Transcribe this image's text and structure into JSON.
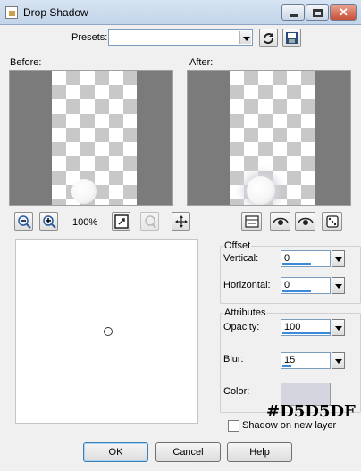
{
  "window": {
    "title": "Drop Shadow"
  },
  "presets": {
    "label": "Presets:",
    "value": ""
  },
  "preview": {
    "before_label": "Before:",
    "after_label": "After:",
    "zoom": "100%"
  },
  "offset": {
    "title": "Offset",
    "vertical_label": "Vertical:",
    "vertical_value": "0",
    "vertical_fill": 0.6,
    "horizontal_label": "Horizontal:",
    "horizontal_value": "0",
    "horizontal_fill": 0.6
  },
  "attributes": {
    "title": "Attributes",
    "opacity_label": "Opacity:",
    "opacity_value": "100",
    "opacity_fill": 1.0,
    "blur_label": "Blur:",
    "blur_value": "15",
    "blur_fill": 0.18,
    "color_label": "Color:",
    "color_value": "#D5D5DF"
  },
  "shadow_new_layer": {
    "label": "Shadow on new layer",
    "checked": false
  },
  "buttons": {
    "ok": "OK",
    "cancel": "Cancel",
    "help": "Help"
  },
  "colors": {
    "accent": "#3c8ad8",
    "swatch": "#D5D5DF",
    "preview_bg": "#7b7b7b"
  }
}
